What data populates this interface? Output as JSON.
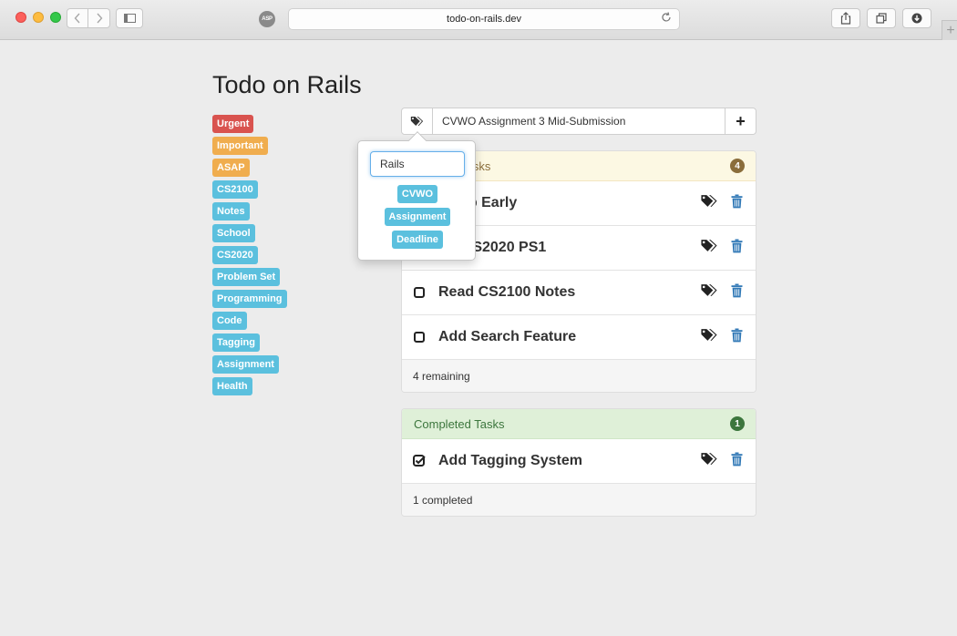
{
  "browser": {
    "url": "todo-on-rails.dev",
    "site_badge": "ASP",
    "plus_glyph": "+"
  },
  "app": {
    "title": "Todo on Rails"
  },
  "tags": [
    {
      "label": "Urgent",
      "color": "#d9534f"
    },
    {
      "label": "Important",
      "color": "#f0ad4e"
    },
    {
      "label": "ASAP",
      "color": "#f0ad4e"
    },
    {
      "label": "CS2100",
      "color": "#5bc0de"
    },
    {
      "label": "Notes",
      "color": "#5bc0de"
    },
    {
      "label": "School",
      "color": "#5bc0de"
    },
    {
      "label": "CS2020",
      "color": "#5bc0de"
    },
    {
      "label": "Problem Set",
      "color": "#5bc0de"
    },
    {
      "label": "Programming",
      "color": "#5bc0de"
    },
    {
      "label": "Code",
      "color": "#5bc0de"
    },
    {
      "label": "Tagging",
      "color": "#5bc0de"
    },
    {
      "label": "Assignment",
      "color": "#5bc0de"
    },
    {
      "label": "Health",
      "color": "#5bc0de"
    }
  ],
  "new_task": {
    "value": "CVWO Assignment 3 Mid-Submission",
    "add_glyph": "+"
  },
  "popover": {
    "value": "Rails",
    "tags": [
      {
        "label": "CVWO",
        "color": "#5bc0de"
      },
      {
        "label": "Assignment",
        "color": "#5bc0de"
      },
      {
        "label": "Deadline",
        "color": "#5bc0de"
      }
    ]
  },
  "pending": {
    "heading": "Pending Tasks",
    "count": "4",
    "tasks": [
      {
        "text": "Sleep Early"
      },
      {
        "text": "Do CS2020 PS1"
      },
      {
        "text": "Read CS2100 Notes"
      },
      {
        "text": "Add Search Feature"
      }
    ],
    "footer": "4 remaining"
  },
  "completed": {
    "heading": "Completed Tasks",
    "count": "1",
    "tasks": [
      {
        "text": "Add Tagging System"
      }
    ],
    "footer": "1 completed"
  },
  "colors": {
    "danger": "#d9534f",
    "warning": "#f0ad4e",
    "info": "#5bc0de",
    "trash": "#337ab7"
  }
}
